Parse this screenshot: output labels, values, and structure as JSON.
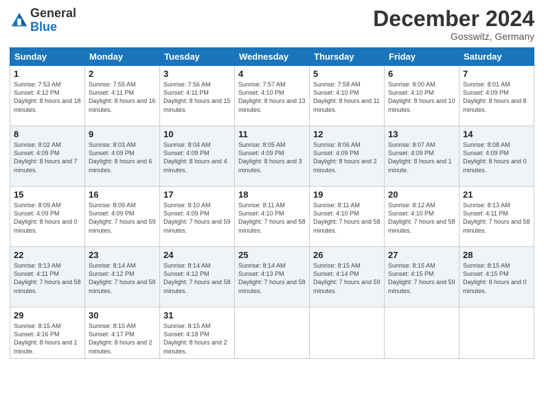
{
  "header": {
    "logo_general": "General",
    "logo_blue": "Blue",
    "month_title": "December 2024",
    "location": "Gosswitz, Germany"
  },
  "weekdays": [
    "Sunday",
    "Monday",
    "Tuesday",
    "Wednesday",
    "Thursday",
    "Friday",
    "Saturday"
  ],
  "weeks": [
    [
      {
        "day": "1",
        "sunrise": "Sunrise: 7:53 AM",
        "sunset": "Sunset: 4:12 PM",
        "daylight": "Daylight: 8 hours and 18 minutes."
      },
      {
        "day": "2",
        "sunrise": "Sunrise: 7:55 AM",
        "sunset": "Sunset: 4:11 PM",
        "daylight": "Daylight: 8 hours and 16 minutes."
      },
      {
        "day": "3",
        "sunrise": "Sunrise: 7:56 AM",
        "sunset": "Sunset: 4:11 PM",
        "daylight": "Daylight: 8 hours and 15 minutes."
      },
      {
        "day": "4",
        "sunrise": "Sunrise: 7:57 AM",
        "sunset": "Sunset: 4:10 PM",
        "daylight": "Daylight: 8 hours and 13 minutes."
      },
      {
        "day": "5",
        "sunrise": "Sunrise: 7:58 AM",
        "sunset": "Sunset: 4:10 PM",
        "daylight": "Daylight: 8 hours and 11 minutes."
      },
      {
        "day": "6",
        "sunrise": "Sunrise: 8:00 AM",
        "sunset": "Sunset: 4:10 PM",
        "daylight": "Daylight: 8 hours and 10 minutes."
      },
      {
        "day": "7",
        "sunrise": "Sunrise: 8:01 AM",
        "sunset": "Sunset: 4:09 PM",
        "daylight": "Daylight: 8 hours and 8 minutes."
      }
    ],
    [
      {
        "day": "8",
        "sunrise": "Sunrise: 8:02 AM",
        "sunset": "Sunset: 4:09 PM",
        "daylight": "Daylight: 8 hours and 7 minutes."
      },
      {
        "day": "9",
        "sunrise": "Sunrise: 8:03 AM",
        "sunset": "Sunset: 4:09 PM",
        "daylight": "Daylight: 8 hours and 6 minutes."
      },
      {
        "day": "10",
        "sunrise": "Sunrise: 8:04 AM",
        "sunset": "Sunset: 4:09 PM",
        "daylight": "Daylight: 8 hours and 4 minutes."
      },
      {
        "day": "11",
        "sunrise": "Sunrise: 8:05 AM",
        "sunset": "Sunset: 4:09 PM",
        "daylight": "Daylight: 8 hours and 3 minutes."
      },
      {
        "day": "12",
        "sunrise": "Sunrise: 8:06 AM",
        "sunset": "Sunset: 4:09 PM",
        "daylight": "Daylight: 8 hours and 2 minutes."
      },
      {
        "day": "13",
        "sunrise": "Sunrise: 8:07 AM",
        "sunset": "Sunset: 4:09 PM",
        "daylight": "Daylight: 8 hours and 1 minute."
      },
      {
        "day": "14",
        "sunrise": "Sunrise: 8:08 AM",
        "sunset": "Sunset: 4:09 PM",
        "daylight": "Daylight: 8 hours and 0 minutes."
      }
    ],
    [
      {
        "day": "15",
        "sunrise": "Sunrise: 8:09 AM",
        "sunset": "Sunset: 4:09 PM",
        "daylight": "Daylight: 8 hours and 0 minutes."
      },
      {
        "day": "16",
        "sunrise": "Sunrise: 8:09 AM",
        "sunset": "Sunset: 4:09 PM",
        "daylight": "Daylight: 7 hours and 59 minutes."
      },
      {
        "day": "17",
        "sunrise": "Sunrise: 8:10 AM",
        "sunset": "Sunset: 4:09 PM",
        "daylight": "Daylight: 7 hours and 59 minutes."
      },
      {
        "day": "18",
        "sunrise": "Sunrise: 8:11 AM",
        "sunset": "Sunset: 4:10 PM",
        "daylight": "Daylight: 7 hours and 58 minutes."
      },
      {
        "day": "19",
        "sunrise": "Sunrise: 8:11 AM",
        "sunset": "Sunset: 4:10 PM",
        "daylight": "Daylight: 7 hours and 58 minutes."
      },
      {
        "day": "20",
        "sunrise": "Sunrise: 8:12 AM",
        "sunset": "Sunset: 4:10 PM",
        "daylight": "Daylight: 7 hours and 58 minutes."
      },
      {
        "day": "21",
        "sunrise": "Sunrise: 8:13 AM",
        "sunset": "Sunset: 4:11 PM",
        "daylight": "Daylight: 7 hours and 58 minutes."
      }
    ],
    [
      {
        "day": "22",
        "sunrise": "Sunrise: 8:13 AM",
        "sunset": "Sunset: 4:11 PM",
        "daylight": "Daylight: 7 hours and 58 minutes."
      },
      {
        "day": "23",
        "sunrise": "Sunrise: 8:14 AM",
        "sunset": "Sunset: 4:12 PM",
        "daylight": "Daylight: 7 hours and 58 minutes."
      },
      {
        "day": "24",
        "sunrise": "Sunrise: 8:14 AM",
        "sunset": "Sunset: 4:12 PM",
        "daylight": "Daylight: 7 hours and 58 minutes."
      },
      {
        "day": "25",
        "sunrise": "Sunrise: 8:14 AM",
        "sunset": "Sunset: 4:13 PM",
        "daylight": "Daylight: 7 hours and 58 minutes."
      },
      {
        "day": "26",
        "sunrise": "Sunrise: 8:15 AM",
        "sunset": "Sunset: 4:14 PM",
        "daylight": "Daylight: 7 hours and 59 minutes."
      },
      {
        "day": "27",
        "sunrise": "Sunrise: 8:15 AM",
        "sunset": "Sunset: 4:15 PM",
        "daylight": "Daylight: 7 hours and 59 minutes."
      },
      {
        "day": "28",
        "sunrise": "Sunrise: 8:15 AM",
        "sunset": "Sunset: 4:15 PM",
        "daylight": "Daylight: 8 hours and 0 minutes."
      }
    ],
    [
      {
        "day": "29",
        "sunrise": "Sunrise: 8:15 AM",
        "sunset": "Sunset: 4:16 PM",
        "daylight": "Daylight: 8 hours and 1 minute."
      },
      {
        "day": "30",
        "sunrise": "Sunrise: 8:15 AM",
        "sunset": "Sunset: 4:17 PM",
        "daylight": "Daylight: 8 hours and 2 minutes."
      },
      {
        "day": "31",
        "sunrise": "Sunrise: 8:15 AM",
        "sunset": "Sunset: 4:18 PM",
        "daylight": "Daylight: 8 hours and 2 minutes."
      },
      null,
      null,
      null,
      null
    ]
  ]
}
